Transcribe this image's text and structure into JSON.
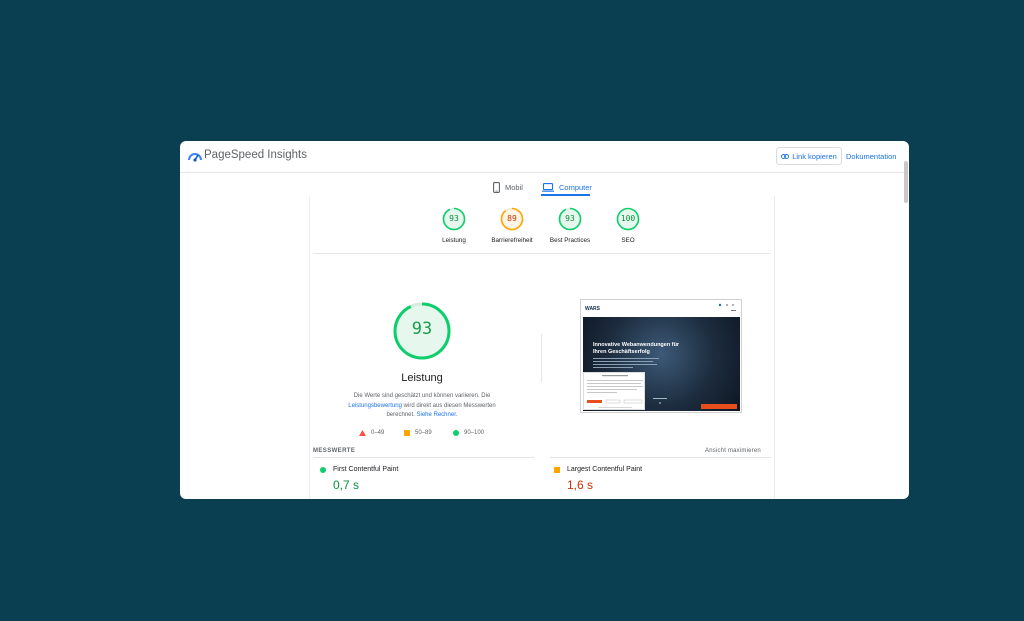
{
  "header": {
    "app_title": "PageSpeed Insights",
    "copy_link_label": "Link kopieren",
    "docs_label": "Dokumentation"
  },
  "tabs": [
    {
      "label": "Mobil",
      "icon": "phone-icon",
      "selected": false
    },
    {
      "label": "Computer",
      "icon": "laptop-icon",
      "selected": true
    }
  ],
  "scores": [
    {
      "value": "93",
      "label": "Leistung",
      "color": "#0cce6b"
    },
    {
      "value": "89",
      "label": "Barrierefreiheit",
      "color": "#ffa400"
    },
    {
      "value": "93",
      "label": "Best Practices",
      "color": "#0cce6b"
    },
    {
      "value": "100",
      "label": "SEO",
      "color": "#0cce6b"
    }
  ],
  "performance": {
    "score": "93",
    "title": "Leistung",
    "desc_1": "Die Werte sind geschätzt und können variieren. Die",
    "desc_link_1": "Leistungsbewertung",
    "desc_2": " wird direkt aus diesen Messwerten berechnet.",
    "desc_link_2": "Siehe Rechner."
  },
  "legend": [
    {
      "range": "0–49",
      "color": "#ff4e42"
    },
    {
      "range": "50–89",
      "color": "#ffa400"
    },
    {
      "range": "90–100",
      "color": "#0cce6b"
    }
  ],
  "metrics": {
    "heading": "MESSWERTE",
    "expand_label": "Ansicht maximieren",
    "items": [
      {
        "name": "First Contentful Paint",
        "value": "0,7 s",
        "color": "#0a8f3c"
      },
      {
        "name": "Largest Contentful Paint",
        "value": "1,6 s",
        "color": "#c33300"
      }
    ]
  },
  "thumbnail": {
    "logo": "WARS",
    "headline": "Innovative Webanwendungen für Ihren Geschäftserfolg"
  },
  "colors": {
    "accent": "#1a73e8",
    "pass": "#0cce6b",
    "average": "#ffa400",
    "fail": "#ff4e42"
  }
}
